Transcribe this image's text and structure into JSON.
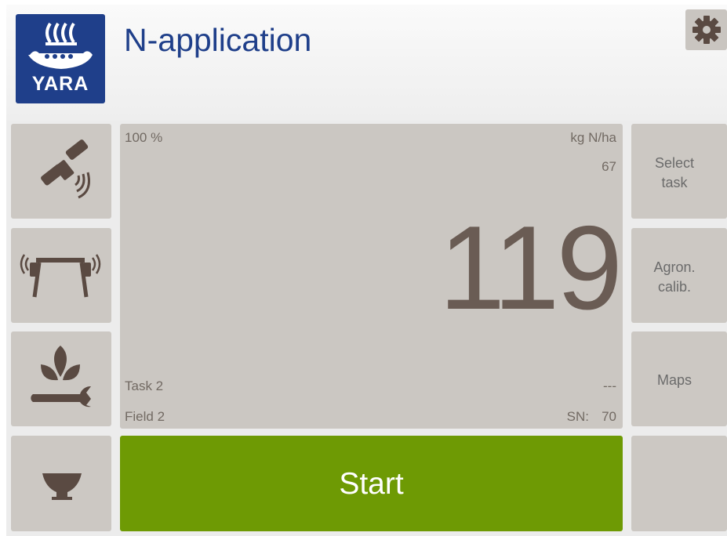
{
  "app": {
    "title": "N-application",
    "logo_text": "YARA"
  },
  "icons": {
    "settings": "gear-icon",
    "gps": "satellite-icon",
    "sensor": "sensor-bridge-icon",
    "crop_settings": "plant-wrench-icon",
    "spreader": "spreader-hopper-icon"
  },
  "panel": {
    "percent": "100 %",
    "unit": "kg N/ha",
    "secondary_value": "67",
    "main_value": "119",
    "task": "Task 2",
    "field": "Field 2",
    "status_dash": "---",
    "sn_label": "SN:",
    "sn_value": "70"
  },
  "right_menu": {
    "select_task": [
      "Select",
      "task"
    ],
    "agron_calib": [
      "Agron.",
      "calib."
    ],
    "maps": "Maps"
  },
  "start_button": {
    "label": "Start"
  },
  "colors": {
    "brand_blue": "#1f3f8a",
    "start_green": "#6e9a04",
    "tile_gray": "#ccc8c3",
    "icon_brown": "#5a4a42"
  }
}
